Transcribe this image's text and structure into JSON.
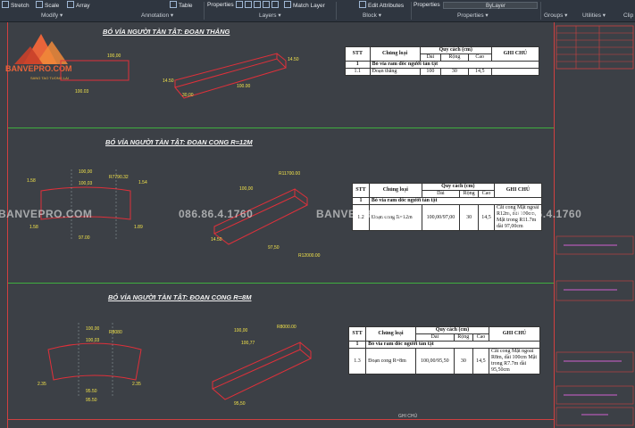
{
  "ribbon": {
    "tools": [
      "Stretch",
      "Scale",
      "Array",
      "Table",
      "Properties",
      "Match Layer",
      "Edit Attributes",
      "Properties"
    ],
    "panels": [
      "Modify",
      "Annotation",
      "Layers",
      "Block",
      "Properties",
      "Groups",
      "Utilities",
      "Clip"
    ],
    "bylayer": "ByLayer"
  },
  "logo": {
    "text": "BANVEPRO.COM",
    "sub": "SANG TAO TUONG LAI"
  },
  "watermark": {
    "site": "BANVEPRO.COM",
    "phone": "086.86.4.1760"
  },
  "sections": [
    {
      "title": "BÓ VỈA NGƯỜI TÀN TẬT:  ĐOẠN THẲNG",
      "dims": [
        "100.03",
        "100,00",
        "14.50",
        "30,00",
        "14.50",
        "100.00"
      ],
      "table": {
        "h_stt": "STT",
        "h_type": "Chủng loại",
        "h_spec": "Quy cách (cm)",
        "h_note": "GHI CHÚ",
        "h_dai": "Dài",
        "h_rong": "Rộng",
        "h_cao": "Cao",
        "group_no": "1",
        "group_name": "Bó vỉa ram dốc người tàn tật",
        "row": {
          "stt": "1.1",
          "name": "Đoạn thẳng",
          "dai": "100",
          "rong": "30",
          "cao": "14,5",
          "note": ""
        }
      }
    },
    {
      "title": "BÓ VỈA NGƯỜI TÀN TẬT: ĐOẠN CONG R=12M",
      "dims": [
        "100,00",
        "100,03",
        "R7790.32",
        "1.58",
        "1.54",
        "1.58",
        "1.89",
        "97.00",
        "R11700.00",
        "R12000.00",
        "100,00",
        "97,50",
        "14.50"
      ],
      "table": {
        "h_stt": "STT",
        "h_type": "Chủng loại",
        "h_spec": "Quy cách (cm)",
        "h_note": "GHI CHÚ",
        "h_dai": "Dài",
        "h_rong": "Rộng",
        "h_cao": "Cao",
        "group_no": "1",
        "group_name": "Bó vỉa ram dốc người tàn tật",
        "row": {
          "stt": "1.2",
          "name": "Đoạn cong R=12m",
          "dai": "100,00/97,00",
          "rong": "30",
          "cao": "14,5",
          "note": "Cắt cong Mặt ngoài R12m, dài 100cm, Mặt trong R11.7m dài 97,00cm"
        }
      }
    },
    {
      "title": "BÓ VỈA NGƯỜI TÀN TẬT: ĐOẠN CONG R=8M",
      "dims": [
        "100,00",
        "100,03",
        "R8080",
        "2.35",
        "2.35",
        "95.50",
        "95.50",
        "R8000.00",
        "100,00",
        "100,77",
        "95,50"
      ],
      "table": {
        "h_stt": "STT",
        "h_type": "Chủng loại",
        "h_spec": "Quy cách (cm)",
        "h_note": "GHI CHÚ",
        "h_dai": "Dài",
        "h_rong": "Rộng",
        "h_cao": "Cao",
        "group_no": "1",
        "group_name": "Bó vỉa ram dốc người tàn tật",
        "row": {
          "stt": "1.3",
          "name": "Đoạn cong R=8m",
          "dai": "100,00/95,50",
          "rong": "30",
          "cao": "14,5",
          "note": "Cắt cong Mặt ngoài R8m, dài 100cm Mặt trong R7.7m dài 95,50cm"
        }
      }
    }
  ],
  "footer": {
    "caption": "GHI CHÚ"
  },
  "colors": {
    "background": "#3c4046",
    "shape": "#e0303a",
    "dimension": "#f3e34a",
    "grid": "#3fae3f"
  }
}
